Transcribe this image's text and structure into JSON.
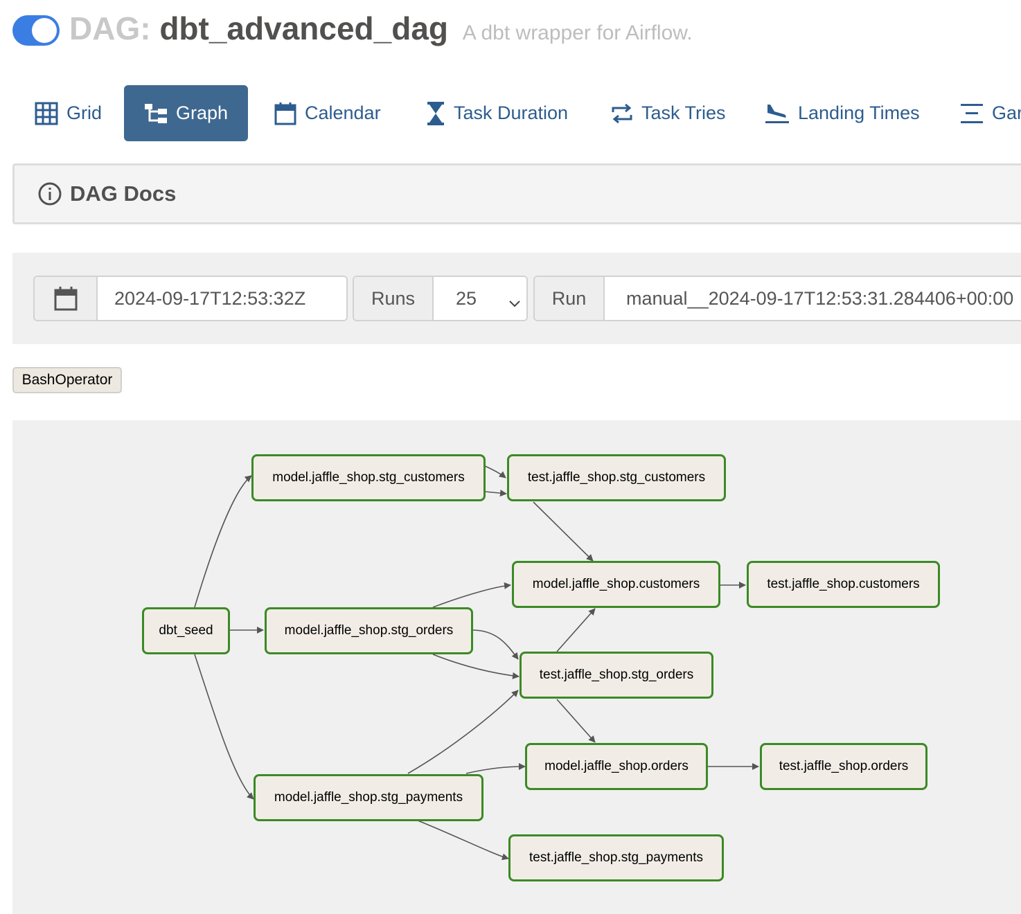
{
  "header": {
    "prefix": "DAG:",
    "dag_id": "dbt_advanced_dag",
    "description": "A dbt wrapper for Airflow.",
    "paused": false
  },
  "nav": {
    "tabs": [
      {
        "label": "Grid",
        "icon": "grid-icon"
      },
      {
        "label": "Graph",
        "icon": "graph-icon",
        "active": true
      },
      {
        "label": "Calendar",
        "icon": "calendar-icon"
      },
      {
        "label": "Task Duration",
        "icon": "hourglass-icon"
      },
      {
        "label": "Task Tries",
        "icon": "retry-icon"
      },
      {
        "label": "Landing Times",
        "icon": "plane-landing-icon"
      },
      {
        "label": "Gar",
        "icon": "gantt-icon"
      }
    ]
  },
  "docs": {
    "label": "DAG Docs",
    "icon": "info-icon"
  },
  "controls": {
    "execution_date": "2024-09-17T12:53:32Z",
    "runs_label": "Runs",
    "runs_value": "25",
    "run_label": "Run",
    "run_value": "manual__2024-09-17T12:53:31.284406+00:00"
  },
  "legend": {
    "operator": "BashOperator"
  },
  "graph": {
    "node_border_color": "#3b8a25",
    "node_fill_color": "#f1ede6",
    "nodes": [
      "dbt_seed",
      "model.jaffle_shop.stg_customers",
      "model.jaffle_shop.stg_orders",
      "model.jaffle_shop.stg_payments",
      "test.jaffle_shop.stg_customers",
      "model.jaffle_shop.customers",
      "test.jaffle_shop.customers",
      "test.jaffle_shop.stg_orders",
      "model.jaffle_shop.orders",
      "test.jaffle_shop.orders",
      "test.jaffle_shop.stg_payments"
    ]
  }
}
